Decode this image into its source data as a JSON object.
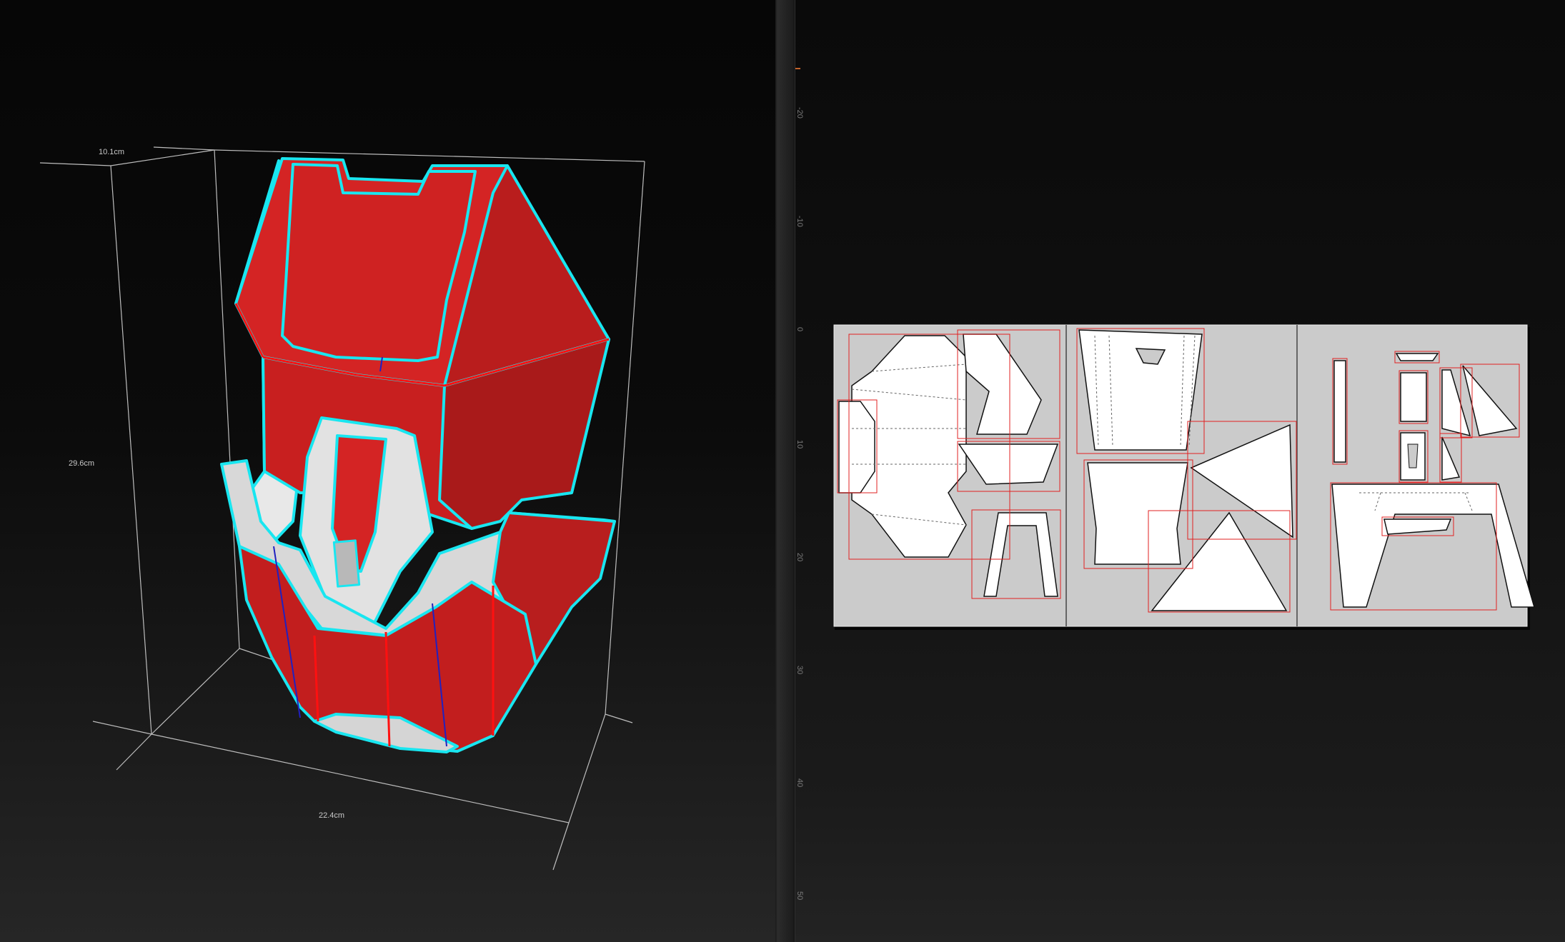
{
  "viewport_3d": {
    "dimensions": {
      "depth": "10.1cm",
      "height": "29.6cm",
      "width": "22.4cm"
    },
    "model": {
      "face_color": "#d42424",
      "edge_color": "#19e6f0",
      "crease_color": "#ff1010",
      "seam_color": "#2020c0"
    }
  },
  "ruler": {
    "labels": [
      "-20",
      "-10",
      "0",
      "10",
      "20",
      "30",
      "40",
      "50"
    ],
    "marker_color": "#c4622a"
  },
  "pattern_sheet": {
    "background": "#cbcbcb",
    "piece_fill": "#ffffff",
    "outline_color": "#e02020",
    "pages": 3
  }
}
